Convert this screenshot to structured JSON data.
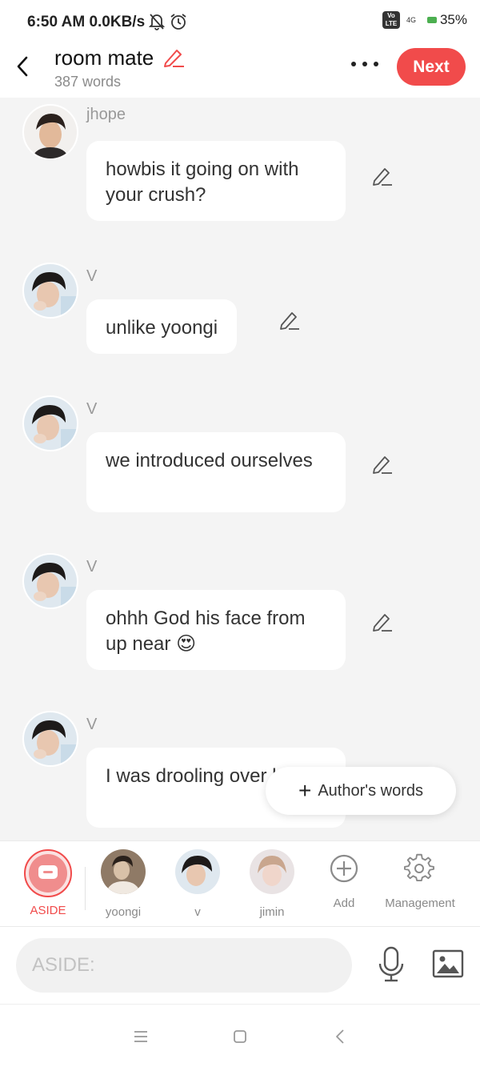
{
  "status_bar": {
    "time": "6:50 AM",
    "speed": "0.0KB/s",
    "volte": "Vo LTE",
    "network": "4G",
    "battery": "35%"
  },
  "header": {
    "title": "room mate",
    "word_count": "387 words",
    "next_label": "Next"
  },
  "messages": [
    {
      "speaker": "jhope",
      "text": "howbis it going on with your crush?"
    },
    {
      "speaker": "V",
      "text": "unlike yoongi"
    },
    {
      "speaker": "V",
      "text": "we introduced ourselves"
    },
    {
      "speaker": "V",
      "text": "ohhh God his face from up near 😍"
    },
    {
      "speaker": "V",
      "text": "I was drooling over him"
    }
  ],
  "author_words_label": "Author's words",
  "characters": {
    "aside": "ASIDE",
    "yoongi": "yoongi",
    "v": "v",
    "jimin": "jimin",
    "add": "Add",
    "management": "Management"
  },
  "input": {
    "placeholder": "ASIDE:"
  },
  "colors": {
    "accent": "#f14b4b",
    "background": "#f4f4f4"
  }
}
